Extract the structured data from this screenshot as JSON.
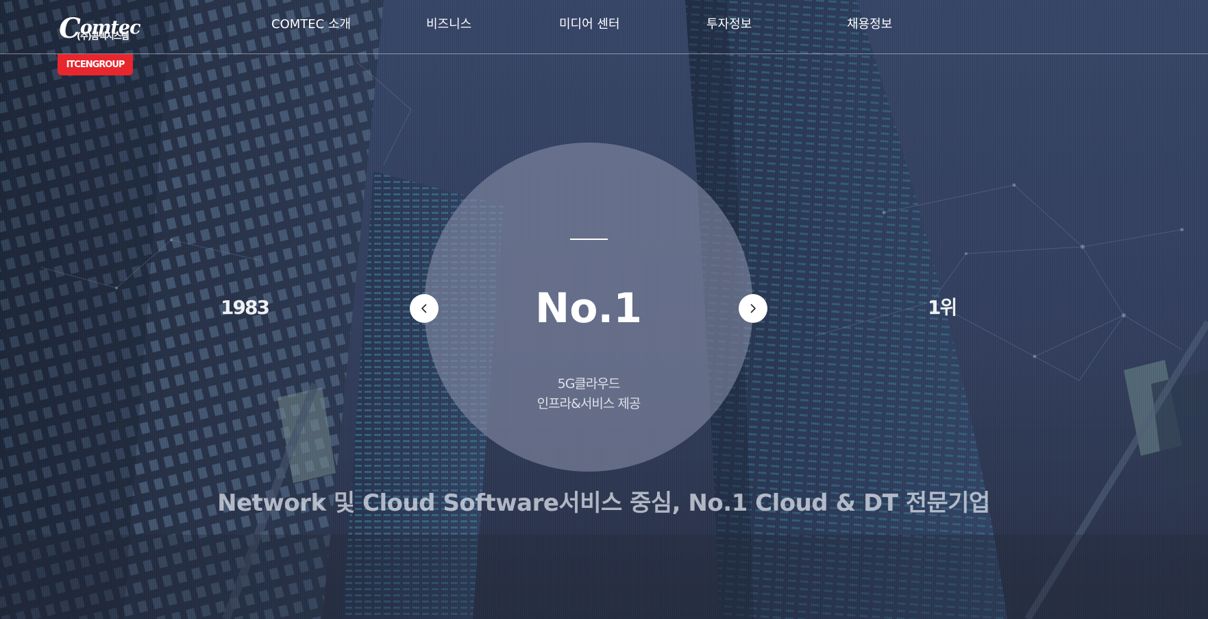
{
  "header": {
    "logo": {
      "mark_initial": "C",
      "mark_rest": "omtec",
      "subtext": "(주)콤텍시스템"
    },
    "group_badge": "ITCENGROUP",
    "nav": [
      {
        "label": "COMTEC 소개"
      },
      {
        "label": "비즈니스"
      },
      {
        "label": "미디어 센터"
      },
      {
        "label": "투자정보"
      },
      {
        "label": "채용정보"
      }
    ]
  },
  "slider": {
    "prev_item": "1983",
    "current_title": "No.1",
    "current_desc": [
      "5G클라우드",
      "인프라&서비스 제공"
    ],
    "next_item": "1위",
    "prev_icon": "chevron-left-icon",
    "next_icon": "chevron-right-icon"
  },
  "tagline": "Network 및 Cloud Software서비스 중심, No.1 Cloud & DT 전문기업",
  "colors": {
    "background": "#33405e",
    "circle": "#848aa4",
    "brand_red": "#e8262d",
    "text": "#ffffff"
  }
}
